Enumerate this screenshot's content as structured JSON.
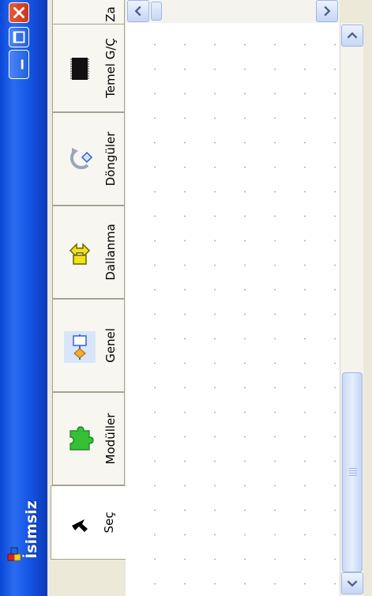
{
  "window": {
    "title": "İsimsiz",
    "accent": "#0a48d6",
    "close_color": "#d8451f"
  },
  "tabs": [
    {
      "label": "Seç",
      "icon": "pointer-arrow-icon",
      "active": true
    },
    {
      "label": "Modüller",
      "icon": "puzzle-piece-icon",
      "active": false
    },
    {
      "label": "Genel",
      "icon": "process-block-icon",
      "active": false
    },
    {
      "label": "Dallanma",
      "icon": "branch-arrows-icon",
      "active": false
    },
    {
      "label": "Döngüler",
      "icon": "loop-arrow-icon",
      "active": false
    },
    {
      "label": "Temel G/Ç",
      "icon": "chip-io-icon",
      "active": false
    },
    {
      "label": "Za",
      "icon": "",
      "active": false
    }
  ]
}
